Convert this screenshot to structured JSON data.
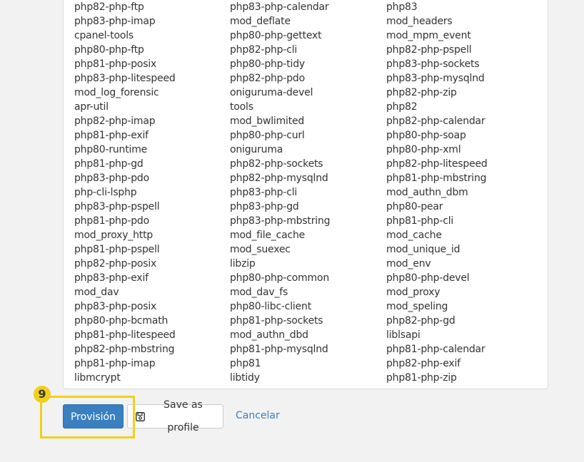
{
  "packages": {
    "col1": [
      "php82-php-ftp",
      "php83-php-imap",
      "cpanel-tools",
      "php80-php-ftp",
      "php81-php-posix",
      "php83-php-litespeed",
      "mod_log_forensic",
      "apr-util",
      "php82-php-imap",
      "php81-php-exif",
      "php80-runtime",
      "php81-php-gd",
      "php83-php-pdo",
      "php-cli-lsphp",
      "php83-php-pspell",
      "php81-php-pdo",
      "mod_proxy_http",
      "php81-php-pspell",
      "php82-php-posix",
      "php83-php-exif",
      "mod_dav",
      "php83-php-posix",
      "php80-php-bcmath",
      "php81-php-litespeed",
      "php82-php-mbstring",
      "php81-php-imap",
      "libmcrypt"
    ],
    "col2": [
      "php83-php-calendar",
      "mod_deflate",
      "php80-php-gettext",
      "php82-php-cli",
      "php80-php-tidy",
      "php82-php-pdo",
      "oniguruma-devel",
      "tools",
      "mod_bwlimited",
      "php80-php-curl",
      "oniguruma",
      "php82-php-sockets",
      "php82-php-mysqlnd",
      "php83-php-cli",
      "php83-php-gd",
      "php83-php-mbstring",
      "mod_file_cache",
      "mod_suexec",
      "libzip",
      "php80-php-common",
      "mod_dav_fs",
      "php80-libc-client",
      "php81-php-sockets",
      "mod_authn_dbd",
      "php81-php-mysqlnd",
      "php81",
      "libtidy"
    ],
    "col3": [
      "php83",
      "mod_headers",
      "mod_mpm_event",
      "php82-php-pspell",
      "php83-php-sockets",
      "php83-php-mysqlnd",
      "php82-php-zip",
      "php82",
      "php82-php-calendar",
      "php80-php-soap",
      "php80-php-xml",
      "php82-php-litespeed",
      "php81-php-mbstring",
      "mod_authn_dbm",
      "php80-pear",
      "php81-php-cli",
      "mod_cache",
      "mod_unique_id",
      "mod_env",
      "php80-php-devel",
      "mod_proxy",
      "mod_speling",
      "php82-php-gd",
      "liblsapi",
      "php81-php-calendar",
      "php82-php-exif",
      "php81-php-zip"
    ]
  },
  "actions": {
    "provision_label": "Provisión",
    "save_profile_label": "Save as profile",
    "save_profile_icon": "floppy-disk-icon",
    "cancel_label": "Cancelar"
  },
  "annotation": {
    "step_number": "9"
  },
  "colors": {
    "primary": "#3a80c0",
    "highlight": "#f1d01c"
  }
}
